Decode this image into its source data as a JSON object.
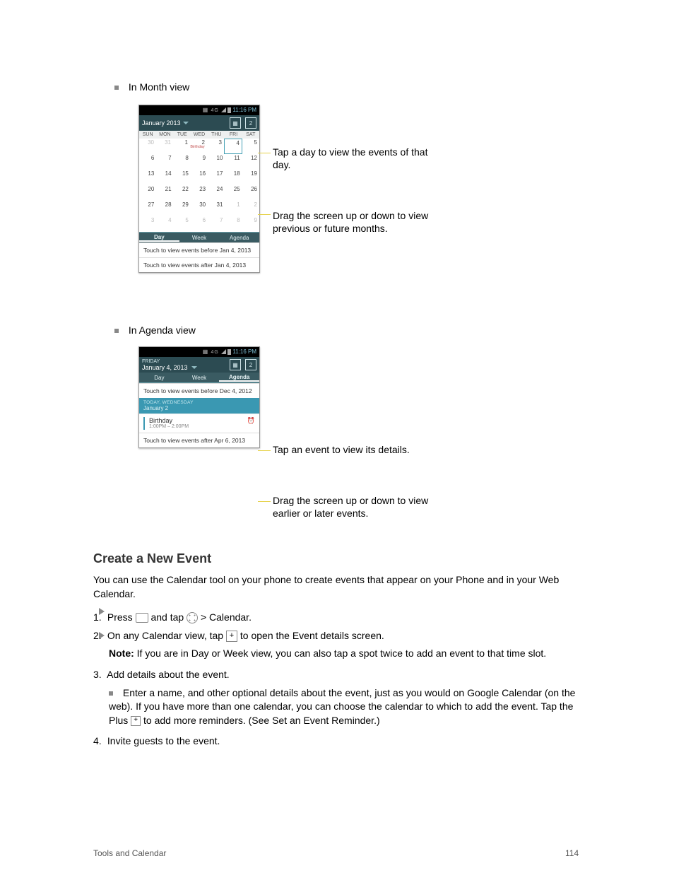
{
  "bullets": {
    "b1": "In Month view",
    "b2": "In Agenda view"
  },
  "status_time": "11:16 PM",
  "month_view": {
    "title": "January 2013",
    "days": [
      "SUN",
      "MON",
      "TUE",
      "WED",
      "THU",
      "FRI",
      "SAT"
    ],
    "rows": [
      [
        {
          "n": "30",
          "dim": true
        },
        {
          "n": "31",
          "dim": true
        },
        {
          "n": "1"
        },
        {
          "n": "2",
          "event": "Birthday"
        },
        {
          "n": "3"
        },
        {
          "n": "4",
          "today": true
        },
        {
          "n": "5"
        }
      ],
      [
        {
          "n": "6"
        },
        {
          "n": "7"
        },
        {
          "n": "8"
        },
        {
          "n": "9"
        },
        {
          "n": "10"
        },
        {
          "n": "11"
        },
        {
          "n": "12"
        }
      ],
      [
        {
          "n": "13"
        },
        {
          "n": "14"
        },
        {
          "n": "15"
        },
        {
          "n": "16"
        },
        {
          "n": "17"
        },
        {
          "n": "18"
        },
        {
          "n": "19"
        }
      ],
      [
        {
          "n": "20"
        },
        {
          "n": "21"
        },
        {
          "n": "22"
        },
        {
          "n": "23"
        },
        {
          "n": "24"
        },
        {
          "n": "25"
        },
        {
          "n": "26"
        }
      ],
      [
        {
          "n": "27"
        },
        {
          "n": "28"
        },
        {
          "n": "29"
        },
        {
          "n": "30"
        },
        {
          "n": "31"
        },
        {
          "n": "1",
          "dim": true
        },
        {
          "n": "2",
          "dim": true
        }
      ],
      [
        {
          "n": "3",
          "dim": true
        },
        {
          "n": "4",
          "dim": true
        },
        {
          "n": "5",
          "dim": true
        },
        {
          "n": "6",
          "dim": true
        },
        {
          "n": "7",
          "dim": true
        },
        {
          "n": "8",
          "dim": true
        },
        {
          "n": "9",
          "dim": true
        }
      ]
    ],
    "tabs": {
      "day": "Day",
      "week": "Week",
      "agenda": "Agenda"
    },
    "touch_before": "Touch to view events before Jan 4, 2013",
    "touch_after": "Touch to view events after Jan 4, 2013",
    "callout_tap": "Tap a day to view the events of that day.",
    "callout_drag": "Drag the screen up or down to view previous or future months."
  },
  "agenda_view": {
    "day_label": "FRIDAY",
    "title": "January 4, 2013",
    "tabs": {
      "day": "Day",
      "week": "Week",
      "agenda": "Agenda"
    },
    "touch_before": "Touch to view events before Dec 4, 2012",
    "date_hdr_small": "TODAY, WEDNESDAY",
    "date_hdr": "January 2",
    "event_title": "Birthday",
    "event_time": "1:00PM – 2:00PM",
    "touch_after": "Touch to view events after Apr 6, 2013",
    "callout_tap": "Tap an event to view its details.",
    "callout_drag": "Drag the screen up or down to view earlier or later events."
  },
  "section": {
    "heading": "Create a New Event",
    "p1": "You can use the Calendar tool on your phone to create events that appear on your Phone and in your Web Calendar.",
    "step1_a": "Press ",
    "step1_b": " and tap ",
    "step1_c": " > Calendar.",
    "step2_a": "On any Calendar view, tap ",
    "step2_b": " to open the Event details screen.",
    "note_a": "Note: If you are in Day or Week view, you can also tap a spot twice to add an event to that time slot.",
    "step3": "Add details about the event.",
    "sub1": "Enter a name, and other optional details about the event, just as you would on Google Calendar (on the web). If you have more than one calendar, you can choose the calendar to which to add the event. Tap the Plus ",
    "sub1_b": " to add more reminders. (See Set an Event Reminder.)",
    "step4": "Invite guests to the event."
  },
  "footer": {
    "left": "Tools and Calendar",
    "right": "114"
  }
}
